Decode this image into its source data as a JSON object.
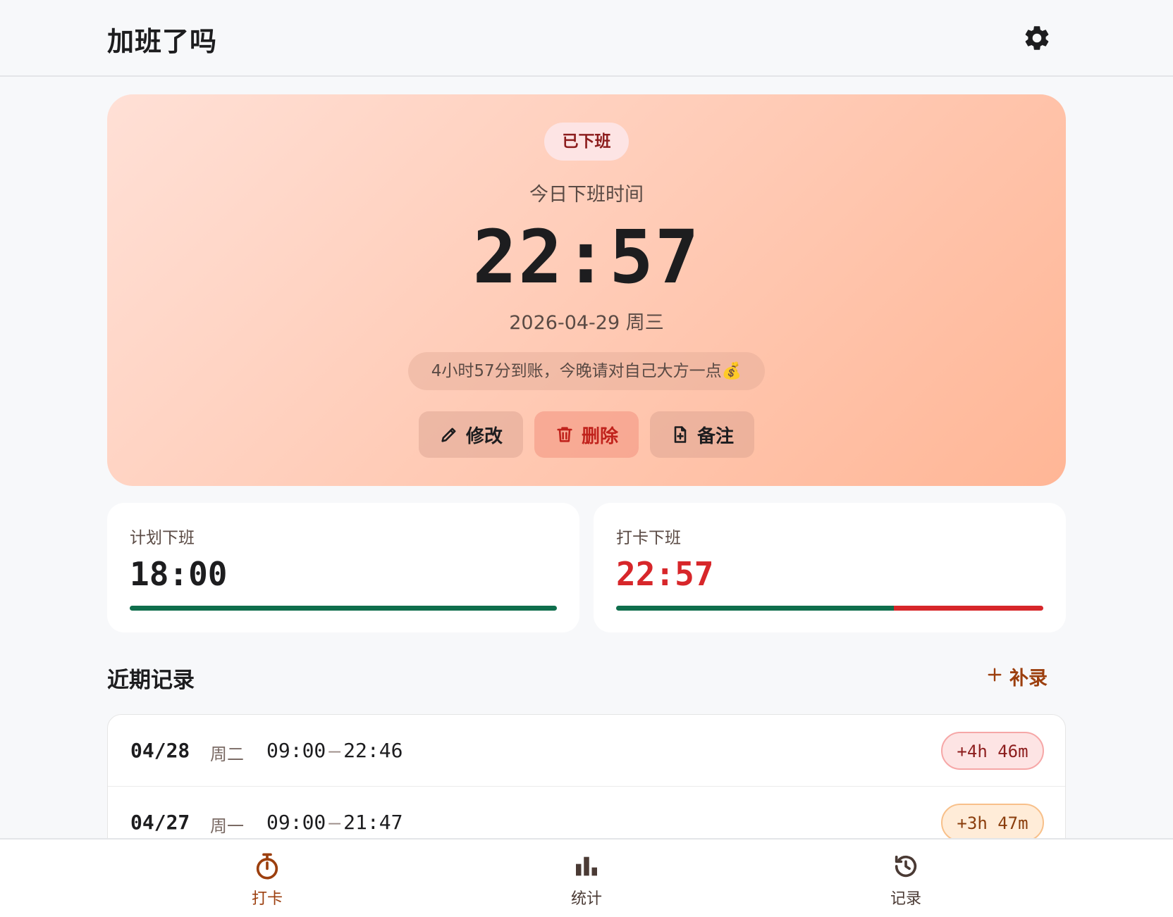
{
  "header": {
    "title": "加班了吗",
    "settings_icon": "gear-icon"
  },
  "hero": {
    "status": "已下班",
    "label": "今日下班时间",
    "time": "22:57",
    "date": "2026-04-29 周三",
    "message": "4小时57分到账，今晚请对自己大方一点💰",
    "actions": {
      "edit": {
        "label": "修改",
        "icon": "pencil-icon"
      },
      "delete": {
        "label": "删除",
        "icon": "trash-icon"
      },
      "note": {
        "label": "备注",
        "icon": "file-plus-icon"
      }
    }
  },
  "stats": {
    "planned": {
      "label": "计划下班",
      "value": "18:00",
      "progress": {
        "normal_fraction": 1.0,
        "overtime_fraction": 0.0
      }
    },
    "actual": {
      "label": "打卡下班",
      "value": "22:57",
      "progress": {
        "normal_fraction": 0.65,
        "overtime_fraction": 0.35
      }
    }
  },
  "recent": {
    "title": "近期记录",
    "add_label": "补录",
    "records": [
      {
        "date": "04/28",
        "weekday": "周二",
        "start": "09:00",
        "end": "22:46",
        "overtime": "+4h 46m",
        "level": "high"
      },
      {
        "date": "04/27",
        "weekday": "周一",
        "start": "09:00",
        "end": "21:47",
        "overtime": "+3h 47m",
        "level": "medium"
      }
    ]
  },
  "nav": {
    "items": [
      {
        "label": "打卡",
        "icon": "stopwatch-icon",
        "active": true
      },
      {
        "label": "统计",
        "icon": "bar-chart-icon",
        "active": false
      },
      {
        "label": "记录",
        "icon": "history-icon",
        "active": false
      }
    ]
  },
  "colors": {
    "accent": "#9c3f0e",
    "danger": "#d7262a",
    "success": "#0f6e4c"
  }
}
